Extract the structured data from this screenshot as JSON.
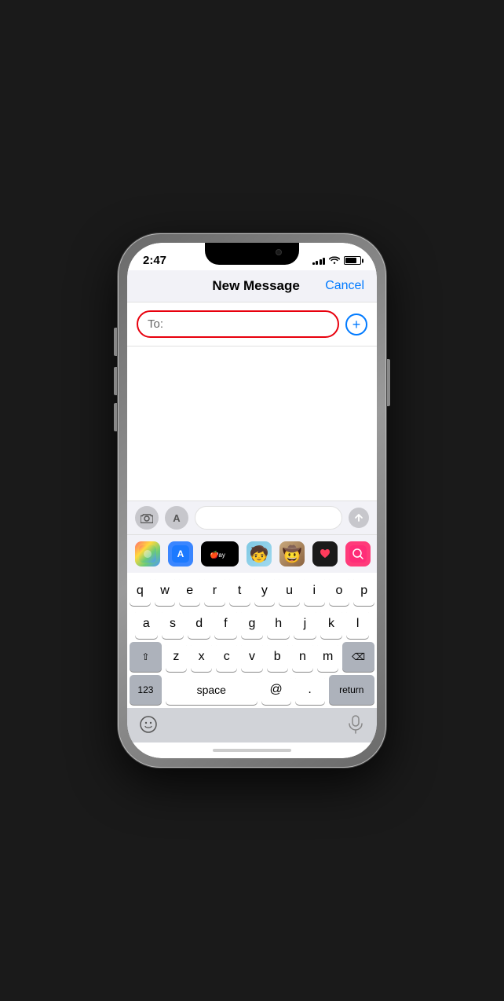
{
  "status_bar": {
    "time": "2:47",
    "signal_bars": [
      3,
      5,
      7,
      9,
      11
    ],
    "battery_level": 75
  },
  "nav": {
    "title": "New Message",
    "cancel_label": "Cancel"
  },
  "to_field": {
    "label": "To:",
    "placeholder": "",
    "add_button_aria": "Add recipient"
  },
  "toolbar": {
    "camera_label": "📷",
    "apps_label": "A",
    "send_label": "↑"
  },
  "app_icons": [
    {
      "name": "photos",
      "emoji": "🖼"
    },
    {
      "name": "appstore",
      "emoji": ""
    },
    {
      "name": "applepay",
      "text": "Pay"
    },
    {
      "name": "memoji1",
      "emoji": "😎"
    },
    {
      "name": "memoji2",
      "emoji": "🤠"
    },
    {
      "name": "heart",
      "emoji": "💝"
    },
    {
      "name": "search",
      "emoji": "🔍"
    }
  ],
  "keyboard": {
    "rows": [
      [
        "q",
        "w",
        "e",
        "r",
        "t",
        "y",
        "u",
        "i",
        "o",
        "p"
      ],
      [
        "a",
        "s",
        "d",
        "f",
        "g",
        "h",
        "j",
        "k",
        "l"
      ],
      [
        "z",
        "x",
        "c",
        "v",
        "b",
        "n",
        "m"
      ]
    ],
    "special_keys": {
      "numbers": "123",
      "space": "space",
      "at": "@",
      "period": ".",
      "return": "return",
      "shift": "⇧",
      "delete": "⌫"
    }
  },
  "bottom_icons": {
    "emoji": "😊",
    "mic": "🎤"
  }
}
